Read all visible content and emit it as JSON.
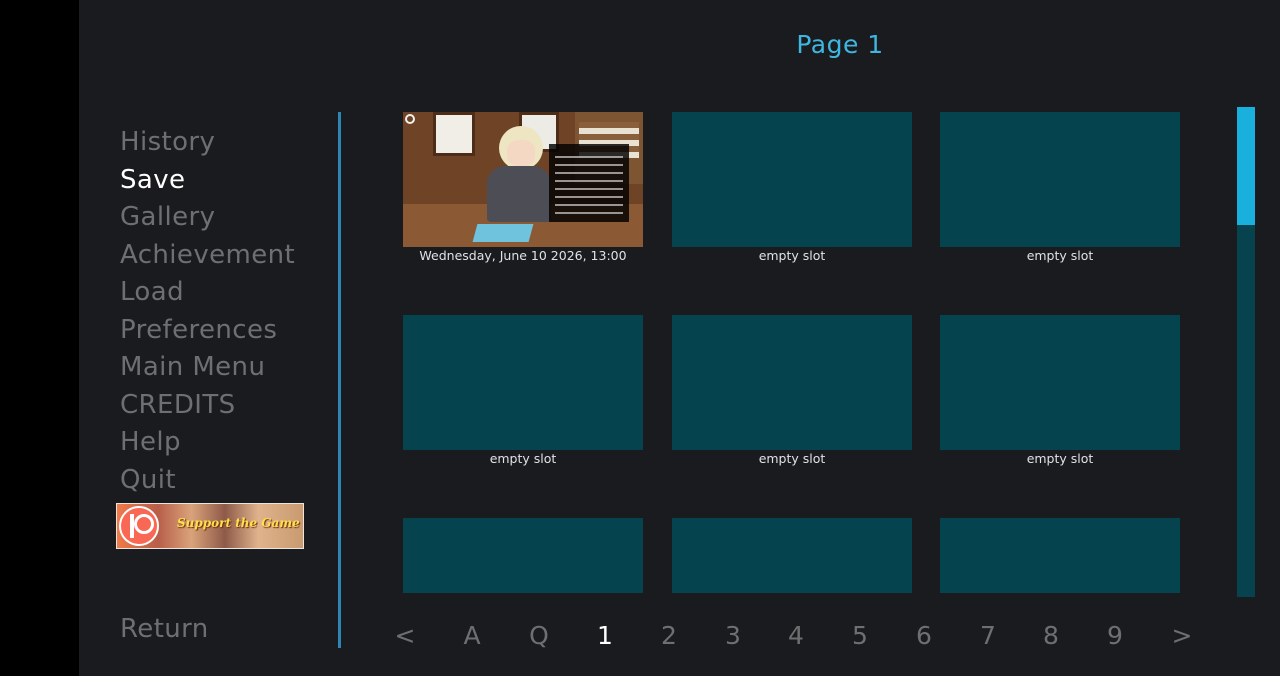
{
  "header": {
    "title": "Page 1"
  },
  "nav": {
    "items": [
      {
        "label": "History",
        "active": false
      },
      {
        "label": "Save",
        "active": true
      },
      {
        "label": "Gallery",
        "active": false
      },
      {
        "label": "Achievement",
        "active": false
      },
      {
        "label": "Load",
        "active": false
      },
      {
        "label": "Preferences",
        "active": false
      },
      {
        "label": "Main Menu",
        "active": false
      },
      {
        "label": "CREDITS",
        "active": false
      },
      {
        "label": "Help",
        "active": false
      },
      {
        "label": "Quit",
        "active": false
      }
    ],
    "return_label": "Return",
    "banner_text": "Support the Game"
  },
  "slots": [
    {
      "label": "Wednesday, June 10 2026, 13:00",
      "filled": true
    },
    {
      "label": "empty slot",
      "filled": false
    },
    {
      "label": "empty slot",
      "filled": false
    },
    {
      "label": "empty slot",
      "filled": false
    },
    {
      "label": "empty slot",
      "filled": false
    },
    {
      "label": "empty slot",
      "filled": false
    },
    {
      "label": "",
      "filled": false
    },
    {
      "label": "",
      "filled": false
    },
    {
      "label": "",
      "filled": false
    }
  ],
  "pager": {
    "prev": "<",
    "auto": "A",
    "quick": "Q",
    "pages": [
      "1",
      "2",
      "3",
      "4",
      "5",
      "6",
      "7",
      "8",
      "9"
    ],
    "current": "1",
    "next": ">"
  },
  "colors": {
    "accent": "#3fb6e0",
    "slot_empty": "#05434f",
    "scroll_thumb": "#1ab0dd",
    "divider": "#2d86b6",
    "idle_text": "#6e6f71"
  }
}
